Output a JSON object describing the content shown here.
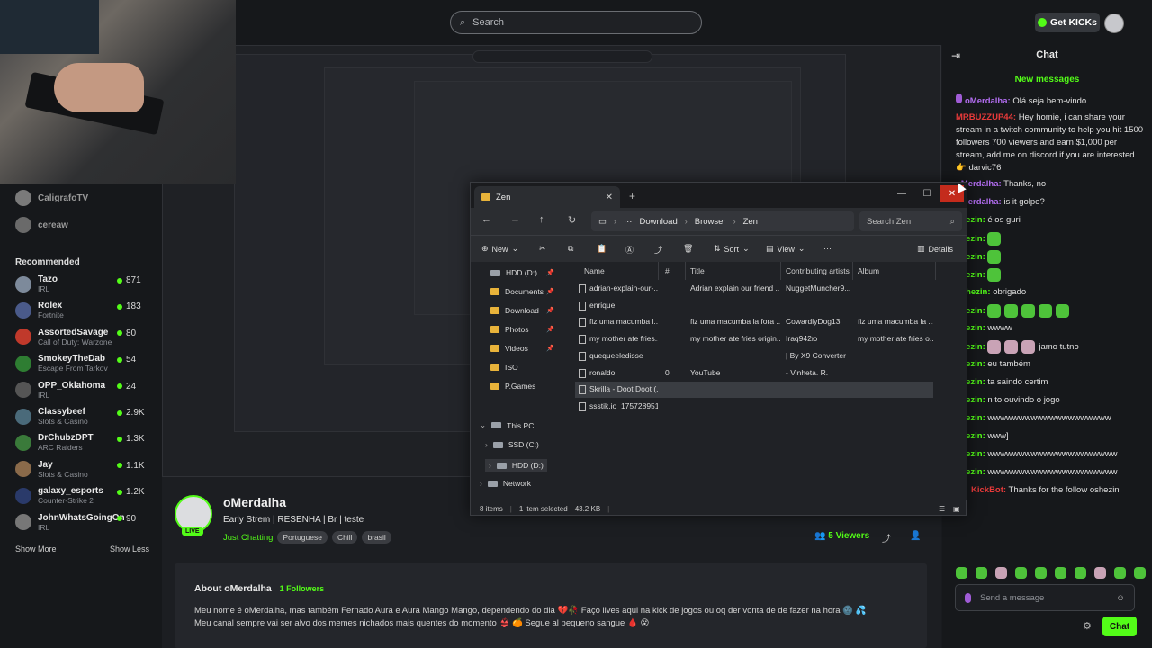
{
  "header": {
    "search_placeholder": "Search",
    "get_kicks": "Get KICKs"
  },
  "sidebar": {
    "following": [
      {
        "name": "CaligrafoTV"
      },
      {
        "name": "cereaw"
      }
    ],
    "recommended_title": "Recommended",
    "recommended": [
      {
        "name": "Tazo",
        "game": "IRL",
        "viewers": "871"
      },
      {
        "name": "Rolex",
        "game": "Fortnite",
        "viewers": "183"
      },
      {
        "name": "AssortedSavage",
        "game": "Call of Duty: Warzone",
        "viewers": "80"
      },
      {
        "name": "SmokeyTheDab",
        "game": "Escape From Tarkov",
        "viewers": "54"
      },
      {
        "name": "OPP_Oklahoma",
        "game": "IRL",
        "viewers": "24"
      },
      {
        "name": "Classybeef",
        "game": "Slots & Casino",
        "viewers": "2.9K"
      },
      {
        "name": "DrChubzDPT",
        "game": "ARC Raiders",
        "viewers": "1.3K"
      },
      {
        "name": "Jay",
        "game": "Slots & Casino",
        "viewers": "1.1K"
      },
      {
        "name": "galaxy_esports",
        "game": "Counter-Strike 2",
        "viewers": "1.2K"
      },
      {
        "name": "JohnWhatsGoingOn",
        "game": "IRL",
        "viewers": "90"
      }
    ],
    "show_more": "Show More",
    "show_less": "Show Less"
  },
  "stream": {
    "name": "oMerdalha",
    "title": "Early Strem | RESENHA | Br | teste",
    "category": "Just Chatting",
    "tags": [
      "Portuguese",
      "Chill",
      "brasil"
    ],
    "live": "LIVE",
    "viewers": "5 Viewers",
    "about_title": "About oMerdalha",
    "followers": "1 Followers",
    "about_line1": "Meu nome é oMerdalha, mas também Fernado Aura e Aura Mango Mango, dependendo do dia 💔🥀 Faço lives aqui na kick de jogos ou oq der vonta de de fazer na hora 🌚 💦",
    "about_line2": "Meu canal sempre vai ser alvo dos memes nichados mais quentes do momento 👙 🍊 Segue al pequeno sangue 🩸 😵"
  },
  "explorer": {
    "tab": "Zen",
    "breadcrumb": [
      "Download",
      "Browser",
      "Zen"
    ],
    "search": "Search Zen",
    "toolbar": {
      "new": "New",
      "sort": "Sort",
      "view": "View",
      "details": "Details"
    },
    "nav": [
      {
        "label": "HDD (D:)"
      },
      {
        "label": "Documents"
      },
      {
        "label": "Download"
      },
      {
        "label": "Photos"
      },
      {
        "label": "Videos"
      },
      {
        "label": "ISO"
      },
      {
        "label": "P.Games"
      },
      {
        "label": "This PC"
      },
      {
        "label": "SSD (C:)"
      },
      {
        "label": "HDD (D:)"
      },
      {
        "label": "Network"
      }
    ],
    "columns": [
      "Name",
      "#",
      "Title",
      "Contributing artists",
      "Album"
    ],
    "rows": [
      {
        "name": "adrian-explain-our-...",
        "num": "",
        "title": "Adrian explain our friend ...",
        "artist": "NuggetMuncher9...",
        "album": ""
      },
      {
        "name": "enrique",
        "num": "",
        "title": "",
        "artist": "",
        "album": ""
      },
      {
        "name": "fiz uma macumba l...",
        "num": "",
        "title": "fiz uma macumba la fora ...",
        "artist": "CowardlyDog13",
        "album": "fiz uma macumba la ..."
      },
      {
        "name": "my mother ate fries...",
        "num": "",
        "title": "my mother ate fries origin...",
        "artist": "Iraq942ю",
        "album": "my mother ate fries o..."
      },
      {
        "name": "quequeeledisse",
        "num": "",
        "title": "",
        "artist": "| By X9 Converter",
        "album": ""
      },
      {
        "name": "ronaldo",
        "num": "0",
        "title": "YouTube",
        "artist": "- Vinheta. R.",
        "album": ""
      },
      {
        "name": "Skrilla - Doot Doot (...",
        "num": "",
        "title": "",
        "artist": "",
        "album": ""
      },
      {
        "name": "ssstik.io_175728951...",
        "num": "",
        "title": "",
        "artist": "",
        "album": ""
      }
    ],
    "status": {
      "items": "8 items",
      "selected": "1 item selected",
      "size": "43.2 KB"
    }
  },
  "chat": {
    "title": "Chat",
    "new_messages": "New messages",
    "messages": [
      {
        "user": "oMerdalha",
        "text": "Olá seja bem-vindo"
      },
      {
        "user": "MRBUZZUP44",
        "text": "Hey homie, i can share your stream in a twitch community to help you hit 1500 followers 700 viewers and earn $1,000 per stream, add me on discord if you are interested 👉 darvic76"
      },
      {
        "user": "oMerdalha",
        "text": "Thanks, no"
      },
      {
        "user": "oMerdalha",
        "text": "is it golpe?"
      },
      {
        "user": "shezin",
        "text": "é os guri"
      },
      {
        "user": "shezin",
        "text": ""
      },
      {
        "user": "shezin",
        "text": ""
      },
      {
        "user": "shezin",
        "text": ""
      },
      {
        "user": "oshezin",
        "text": "obrigado"
      },
      {
        "user": "shezin",
        "text": ""
      },
      {
        "user": "shezin",
        "text": "wwww"
      },
      {
        "user": "shezin",
        "text": "jamo tutno"
      },
      {
        "user": "shezin",
        "text": "eu também"
      },
      {
        "user": "shezin",
        "text": "ta saindo certim"
      },
      {
        "user": "shezin",
        "text": "n to ouvindo o jogo"
      },
      {
        "user": "shezin",
        "text": "wwwwwwwwwwwwwwwwwwww"
      },
      {
        "user": "shezin",
        "text": "www]"
      },
      {
        "user": "shezin",
        "text": "wwwwwwwwwwwwwwwwwwwww"
      },
      {
        "user": "shezin",
        "text": "wwwwwwwwwwwwwwwwwwwww"
      },
      {
        "user": "KickBot",
        "text": "Thanks for the follow oshezin"
      }
    ],
    "placeholder": "Send a message",
    "send": "Chat"
  }
}
